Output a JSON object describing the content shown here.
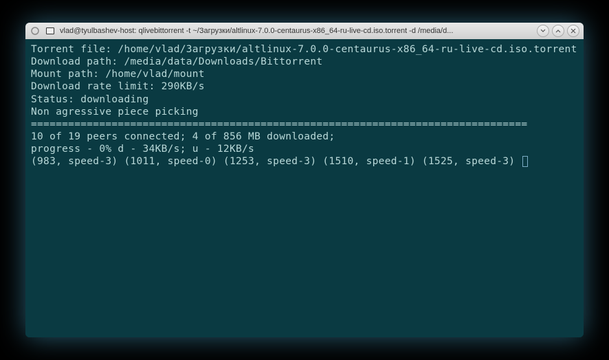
{
  "window": {
    "title": "vlad@tyulbashev-host: qlivebittorrent -t ~/Загрузки/altlinux-7.0.0-centaurus-x86_64-ru-live-cd.iso.torrent -d /media/d..."
  },
  "terminal": {
    "torrent_file_label": "Torrent file: ",
    "torrent_file_value": "/home/vlad/Загрузки/altlinux-7.0.0-centaurus-x86_64-ru-live-cd.iso.torrent",
    "download_path_label": "Download path: ",
    "download_path_value": "/media/data/Downloads/Bittorrent",
    "mount_path_label": "Mount path: ",
    "mount_path_value": "/home/vlad/mount",
    "rate_limit_label": "Download rate limit: ",
    "rate_limit_value": "290KB/s",
    "status_label": "Status: ",
    "status_value": "downloading",
    "piece_picking": "Non agressive piece picking",
    "separator": "================================================================================",
    "peers_line": "10 of 19 peers connected; 4 of 856 MB downloaded;",
    "progress_line": "progress - 0% d - 34KB/s; u - 12KB/s",
    "speeds_line": "(983, speed-3) (1011, speed-0) (1253, speed-3) (1510, speed-1) (1525, speed-3) "
  }
}
